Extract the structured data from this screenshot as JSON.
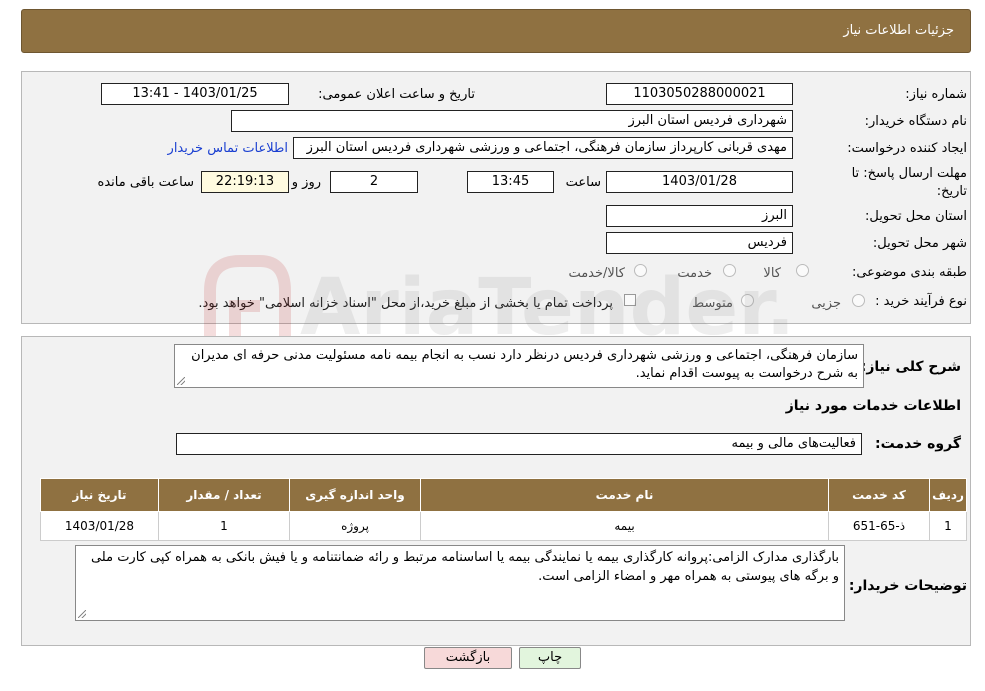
{
  "header": {
    "title": "جزئیات اطلاعات نیاز"
  },
  "fields": {
    "need_number_label": "شماره نیاز:",
    "need_number": "1103050288000021",
    "announce_label": "تاریخ و ساعت اعلان عمومی:",
    "announce_value": "1403/01/25 - 13:41",
    "buyer_org_label": "نام دستگاه خریدار:",
    "buyer_org": "شهرداری فردیس استان البرز",
    "requester_label": "ایجاد کننده درخواست:",
    "requester": "مهدی قربانی کارپرداز سازمان فرهنگی، اجتماعی و ورزشی شهرداری فردیس استان البرز",
    "contact_link": "اطلاعات تماس خریدار",
    "deadline_label_1": "مهلت ارسال پاسخ: تا",
    "deadline_label_2": "تاریخ:",
    "deadline_date": "1403/01/28",
    "time_label": "ساعت",
    "deadline_time": "13:45",
    "days_value": "2",
    "days_label": "روز و",
    "remaining_time": "22:19:13",
    "remaining_label": "ساعت باقی مانده",
    "province_label": "استان محل تحویل:",
    "province": "البرز",
    "city_label": "شهر محل تحویل:",
    "city": "فردیس",
    "category_label": "طبقه بندی موضوعی:",
    "category_options": [
      "کالا",
      "خدمت",
      "کالا/خدمت"
    ],
    "purchase_type_label": "نوع فرآیند خرید :",
    "purchase_options": [
      "جزیی",
      "متوسط"
    ],
    "payment_note": "پرداخت تمام یا بخشی از مبلغ خرید،از محل \"اسناد خزانه اسلامی\" خواهد بود."
  },
  "summary": {
    "label": "شرح کلی نیاز:",
    "text": "سازمان فرهنگی، اجتماعی و ورزشی شهرداری فردیس درنظر دارد نسب به انجام بیمه نامه مسئولیت مدنی حرفه ای مدیران به شرح درخواست به پیوست اقدام نماید.",
    "services_title": "اطلاعات خدمات مورد نیاز",
    "group_label": "گروه خدمت:",
    "group_value": "فعالیت‌های مالی و بیمه"
  },
  "table": {
    "headers": [
      "ردیف",
      "کد خدمت",
      "نام خدمت",
      "واحد اندازه گیری",
      "تعداد / مقدار",
      "تاریخ نیاز"
    ],
    "rows": [
      [
        "1",
        "ذ-65-651",
        "بیمه",
        "پروژه",
        "1",
        "1403/01/28"
      ]
    ]
  },
  "buyer_notes": {
    "label": "توضیحات خریدار:",
    "text": "بارگذاری مدارک الزامی:پروانه کارگذاری بیمه یا نمایندگی بیمه یا اساسنامه مرتبط و رائه ضمانتنامه و یا فیش بانکی به همراه کپی کارت ملی و برگه های پیوستی به همراه مهر و امضاء الزامی است."
  },
  "buttons": {
    "print": "چاپ",
    "back": "بازگشت"
  },
  "watermark": {
    "text": "AriaTender.net"
  },
  "colors": {
    "header_bg": "#8f7141",
    "back_button_bg": "#f7d9d9",
    "print_button_bg": "#e2f5dd",
    "link": "#1a3fd1"
  }
}
